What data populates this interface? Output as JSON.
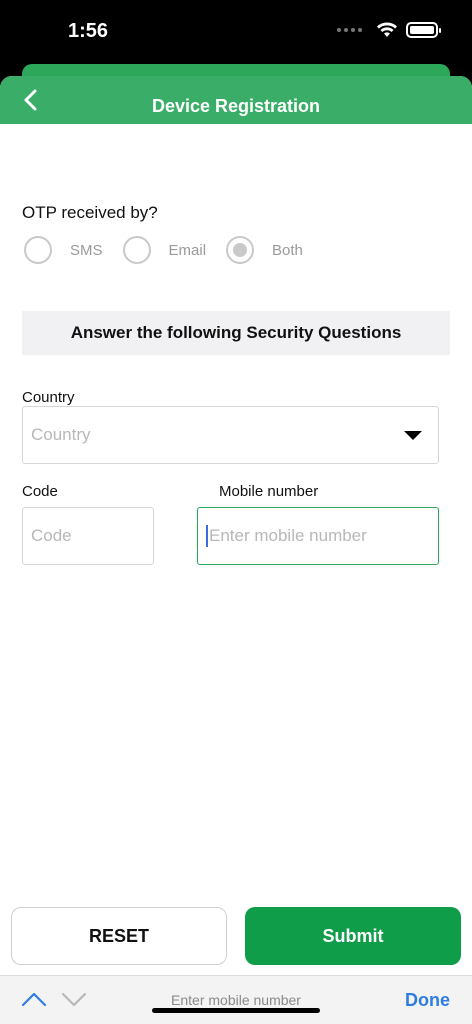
{
  "status": {
    "time": "1:56"
  },
  "nav": {
    "title": "Device Registration"
  },
  "otp": {
    "label": "OTP received by?",
    "options": [
      {
        "label": "SMS",
        "selected": false
      },
      {
        "label": "Email",
        "selected": false
      },
      {
        "label": "Both",
        "selected": true
      }
    ]
  },
  "security": {
    "title": "Answer the following Security Questions"
  },
  "form": {
    "country_label": "Country",
    "country_placeholder": "Country",
    "code_label": "Code",
    "code_placeholder": "Code",
    "mobile_label": "Mobile number",
    "mobile_placeholder": "Enter mobile number"
  },
  "buttons": {
    "reset": "RESET",
    "submit": "Submit"
  },
  "keyboard_toolbar": {
    "hint": "Enter mobile number",
    "done": "Done"
  },
  "colors": {
    "brand_green": "#3aae68",
    "submit_green": "#0f9d4a",
    "link_blue": "#2f7de1"
  }
}
